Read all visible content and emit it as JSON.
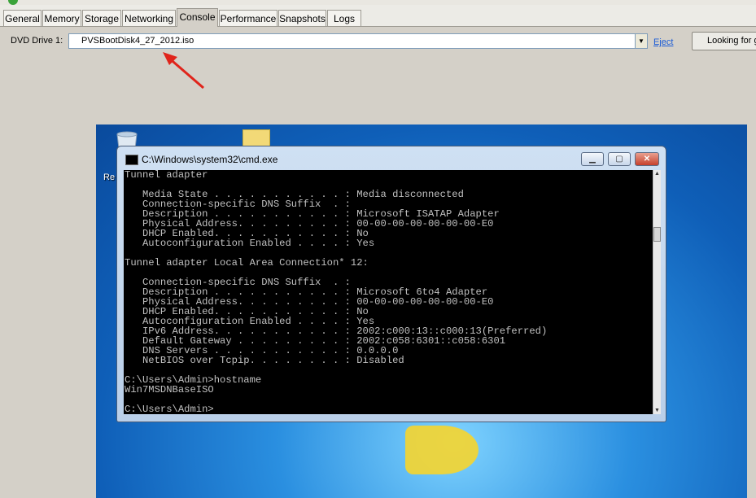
{
  "tabs": [
    "General",
    "Memory",
    "Storage",
    "Networking",
    "Console",
    "Performance",
    "Snapshots",
    "Logs"
  ],
  "active_tab": "Console",
  "dvd": {
    "label": "DVD Drive 1:",
    "value": "PVSBootDisk4_27_2012.iso",
    "eject_label": "Eject",
    "looking_button": "Looking for g"
  },
  "desktop": {
    "recycle_label": "Re"
  },
  "cmd": {
    "title": "C:\\Windows\\system32\\cmd.exe",
    "lines": [
      "Tunnel adapter                      :",
      "",
      "   Media State . . . . . . . . . . . : Media disconnected",
      "   Connection-specific DNS Suffix  . :",
      "   Description . . . . . . . . . . . : Microsoft ISATAP Adapter",
      "   Physical Address. . . . . . . . . : 00-00-00-00-00-00-00-E0",
      "   DHCP Enabled. . . . . . . . . . . : No",
      "   Autoconfiguration Enabled . . . . : Yes",
      "",
      "Tunnel adapter Local Area Connection* 12:",
      "",
      "   Connection-specific DNS Suffix  . :",
      "   Description . . . . . . . . . . . : Microsoft 6to4 Adapter",
      "   Physical Address. . . . . . . . . : 00-00-00-00-00-00-00-E0",
      "   DHCP Enabled. . . . . . . . . . . : No",
      "   Autoconfiguration Enabled . . . . : Yes",
      "   IPv6 Address. . . . . . . . . . . : 2002:c000:13::c000:13(Preferred)",
      "   Default Gateway . . . . . . . . . : 2002:c058:6301::c058:6301",
      "   DNS Servers . . . . . . . . . . . : 0.0.0.0",
      "   NetBIOS over Tcpip. . . . . . . . : Disabled",
      "",
      "C:\\Users\\Admin>hostname",
      "Win7MSDNBaseISO",
      "",
      "C:\\Users\\Admin>"
    ]
  },
  "colors": {
    "annotation_arrow": "#e0241b",
    "desktop_bg": "#1a6fcc",
    "console_bg": "#000000",
    "console_text": "#c0c0c0"
  }
}
